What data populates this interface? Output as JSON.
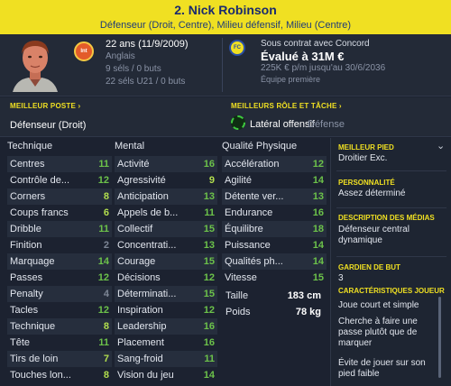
{
  "header": {
    "name": "2. Nick Robinson",
    "positions": "Défenseur (Droit, Centre), Milieu défensif, Milieu (Centre)"
  },
  "player": {
    "age": "22 ans (11/9/2009)",
    "nationality": "Anglais",
    "caps": "9 séls / 0 buts",
    "u21_caps": "22 séls U21 / 0 buts",
    "club_badge": "Int"
  },
  "contract": {
    "status": "Sous contrat avec Concord",
    "value": "Évalué à 31M €",
    "wage": "225K € p/m jusqu'au 30/6/2036",
    "team": "Équipe première",
    "badge": "FC"
  },
  "roles": {
    "best_position_label": "MEILLEUR POSTE",
    "best_position": "Défenseur (Droit)",
    "best_role_label": "MEILLEURS RÔLE ET TÂCHE",
    "best_role": "Latéral offensif",
    "best_duty": "Défense"
  },
  "columns": {
    "technical": "Technique",
    "mental": "Mental",
    "physical": "Qualité Physique"
  },
  "technical": [
    {
      "label": "Centres",
      "value": "11"
    },
    {
      "label": "Contrôle de...",
      "value": "12"
    },
    {
      "label": "Corners",
      "value": "8"
    },
    {
      "label": "Coups francs",
      "value": "6"
    },
    {
      "label": "Dribble",
      "value": "11"
    },
    {
      "label": "Finition",
      "value": "2"
    },
    {
      "label": "Marquage",
      "value": "14"
    },
    {
      "label": "Passes",
      "value": "12"
    },
    {
      "label": "Penalty",
      "value": "4"
    },
    {
      "label": "Tacles",
      "value": "12"
    },
    {
      "label": "Technique",
      "value": "8"
    },
    {
      "label": "Tête",
      "value": "11"
    },
    {
      "label": "Tirs de loin",
      "value": "7"
    },
    {
      "label": "Touches lon...",
      "value": "8"
    }
  ],
  "mental": [
    {
      "label": "Activité",
      "value": "16"
    },
    {
      "label": "Agressivité",
      "value": "9"
    },
    {
      "label": "Anticipation",
      "value": "13"
    },
    {
      "label": "Appels de b...",
      "value": "11"
    },
    {
      "label": "Collectif",
      "value": "15"
    },
    {
      "label": "Concentrati...",
      "value": "13"
    },
    {
      "label": "Courage",
      "value": "15"
    },
    {
      "label": "Décisions",
      "value": "12"
    },
    {
      "label": "Déterminati...",
      "value": "15"
    },
    {
      "label": "Inspiration",
      "value": "12"
    },
    {
      "label": "Leadership",
      "value": "16"
    },
    {
      "label": "Placement",
      "value": "16"
    },
    {
      "label": "Sang-froid",
      "value": "11"
    },
    {
      "label": "Vision du jeu",
      "value": "14"
    }
  ],
  "physical": [
    {
      "label": "Accélération",
      "value": "12"
    },
    {
      "label": "Agilité",
      "value": "14"
    },
    {
      "label": "Détente ver...",
      "value": "13"
    },
    {
      "label": "Endurance",
      "value": "16"
    },
    {
      "label": "Équilibre",
      "value": "18"
    },
    {
      "label": "Puissance",
      "value": "14"
    },
    {
      "label": "Qualités ph...",
      "value": "14"
    },
    {
      "label": "Vitesse",
      "value": "15"
    }
  ],
  "body": {
    "height_label": "Taille",
    "height": "183 cm",
    "weight_label": "Poids",
    "weight": "78 kg"
  },
  "side": {
    "foot_label": "MEILLEUR PIED",
    "foot": "Droitier Exc.",
    "personality_label": "PERSONNALITÉ",
    "personality": "Assez déterminé",
    "media_label": "DESCRIPTION DES MÉDIAS",
    "media": "Défenseur central dynamique",
    "gk_label": "GARDIEN DE BUT",
    "gk": "3",
    "traits_label": "CARACTÉRISTIQUES JOUEUR",
    "traits": [
      "Joue court et simple",
      "Cherche à faire une passe plutôt que de marquer",
      "Évite de jouer sur son pied faible"
    ]
  },
  "colors": {
    "header_bg": "#f0e022",
    "attr_high": "#6cc24a",
    "attr_mid": "#b2de4e",
    "attr_low": "#7d8696"
  }
}
